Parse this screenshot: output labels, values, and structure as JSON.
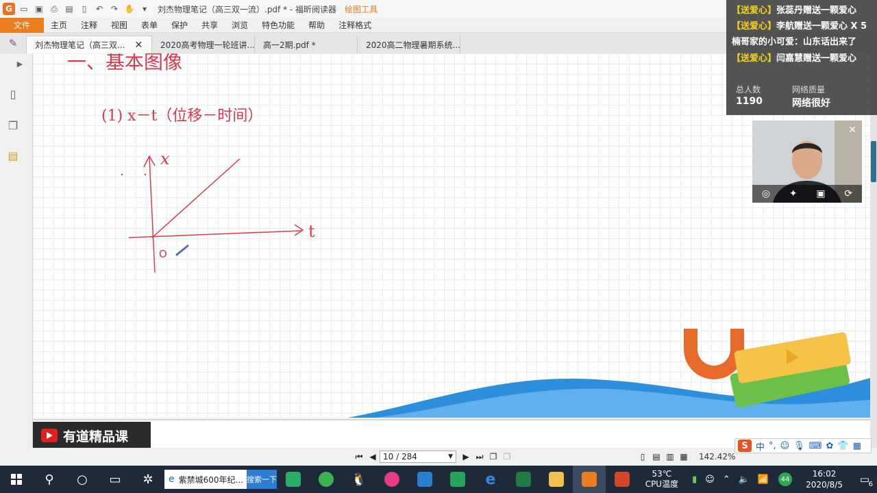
{
  "window": {
    "title": "刘杰物理笔记（高三双一流）.pdf * - 福昕阅读器",
    "context_tool": "绘图工具"
  },
  "menubar": {
    "file": "文件",
    "items": [
      "主页",
      "注释",
      "视图",
      "表单",
      "保护",
      "共享",
      "浏览",
      "特色功能",
      "帮助",
      "注释格式"
    ]
  },
  "tabs": [
    {
      "label": "刘杰物理笔记（高三双...",
      "active": true
    },
    {
      "label": "2020高考物理一轮班讲...",
      "active": false
    },
    {
      "label": "高一2期.pdf *",
      "active": false
    },
    {
      "label": "2020高二物理暑期系统...",
      "active": false
    }
  ],
  "note": {
    "heading": "一、基本图像",
    "subheading": "(1) x－t（位移－时间）",
    "axis_x": "x",
    "axis_t": "t",
    "origin": "O"
  },
  "branding": {
    "youdao": "有道精品课"
  },
  "statusbar": {
    "page_display": "10 / 284",
    "zoom": "142.42%"
  },
  "live": {
    "messages": [
      {
        "tag": "【送爱心】",
        "text": "张蕊丹赠送一颗爱心"
      },
      {
        "tag": "【送爱心】",
        "text": "李航赠送一颗爱心 X 5"
      },
      {
        "tag": "",
        "text": "楠哥家的小可爱：山东话出来了"
      },
      {
        "tag": "【送爱心】",
        "text": "闫嘉慧赠送一颗爱心"
      }
    ],
    "total_label": "总人数",
    "total_value": "1190",
    "network_label": "网络质量",
    "network_value": "网络很好"
  },
  "ime": {
    "mode": "中",
    "punct": "°,"
  },
  "taskbar": {
    "search_text": "紫禁城600年纪...",
    "search_button": "搜索一下",
    "temp": "53℃",
    "temp_label": "CPU温度",
    "badge": "44",
    "time": "16:02",
    "date": "2020/8/5",
    "notifications": "6"
  },
  "colors": {
    "accent": "#ea7d1e",
    "ink_red": "#d93a4a",
    "wave_blue": "#2d8fdc",
    "gift_tag": "#f3d51c"
  }
}
